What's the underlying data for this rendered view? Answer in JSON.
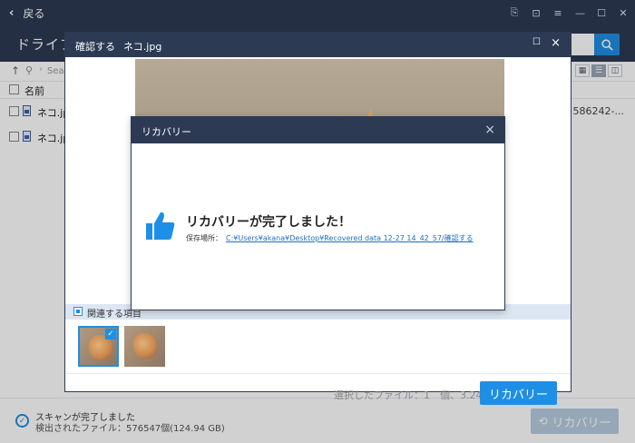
{
  "topbar": {
    "back_label": "戻る"
  },
  "header": {
    "title": "ドライブ ("
  },
  "toolbar": {
    "search_placeholder": "Sea"
  },
  "columns": {
    "name": "名前"
  },
  "files": [
    {
      "name": "ネコ.jp",
      "path": "586242-..."
    },
    {
      "name": "ネコ.jp",
      "path": ""
    }
  ],
  "status": {
    "scan_done": "スキャンが完了しました",
    "found_files": "検出されたファイル：576547個(124.94 GB)",
    "recover_label": "リカバリー"
  },
  "confirm": {
    "title": "確認する",
    "filename": "ネコ.jpg",
    "related_label": "関連する項目",
    "selection_info": "選択したファイル：1　個、3.24 MB",
    "recover_label": "リカバリー"
  },
  "recovery_modal": {
    "title": "リカバリー",
    "message": "リカバリーが完了しました！",
    "path_label": "保存場所：",
    "path": "C:¥Users¥akana¥Desktop¥Recovered data 12-27 14_42_57/確認する"
  },
  "colors": {
    "accent": "#1e8fe6",
    "titlebar": "#2c3a54"
  }
}
